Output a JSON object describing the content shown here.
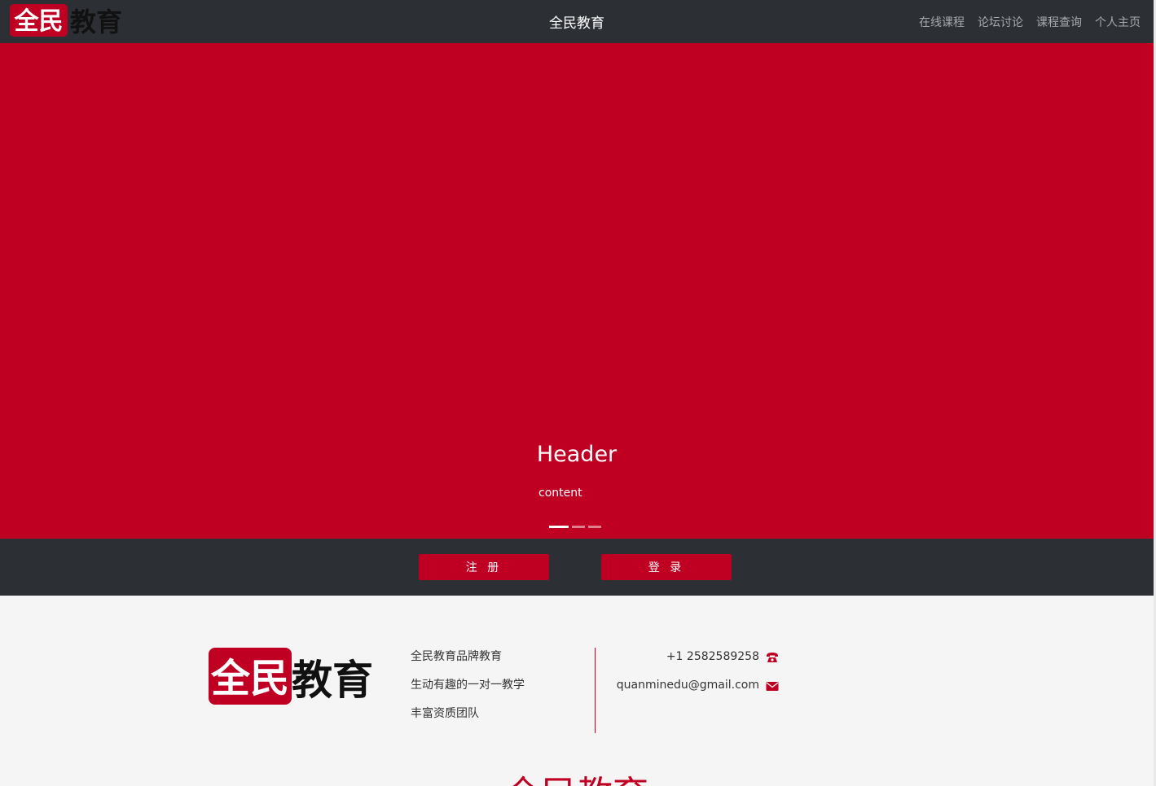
{
  "navbar": {
    "logo_text_a": "全民",
    "logo_text_b": "教育",
    "brand": "全民教育",
    "links": [
      "在线课程",
      "论坛讨论",
      "课程查询",
      "个人主页"
    ]
  },
  "carousel": {
    "title": "Header",
    "text": "content",
    "slide_count": 3,
    "active_index": 0
  },
  "auth": {
    "register_label": "注 册",
    "login_label": "登 录"
  },
  "footer": {
    "logo_text_a": "全民",
    "logo_text_b": "教育",
    "slogans": [
      "全民教育品牌教育",
      "生动有趣的一对一教学",
      "丰富资质团队"
    ],
    "phone": "+1 2582589258",
    "email": "quanminedu@gmail.com",
    "phone_icon": "phone-icon",
    "email_icon": "envelope-icon",
    "big_brand": "全民教育"
  },
  "colors": {
    "accent": "#bf0023",
    "dark": "#2c3034",
    "light": "#f5f5f5"
  }
}
